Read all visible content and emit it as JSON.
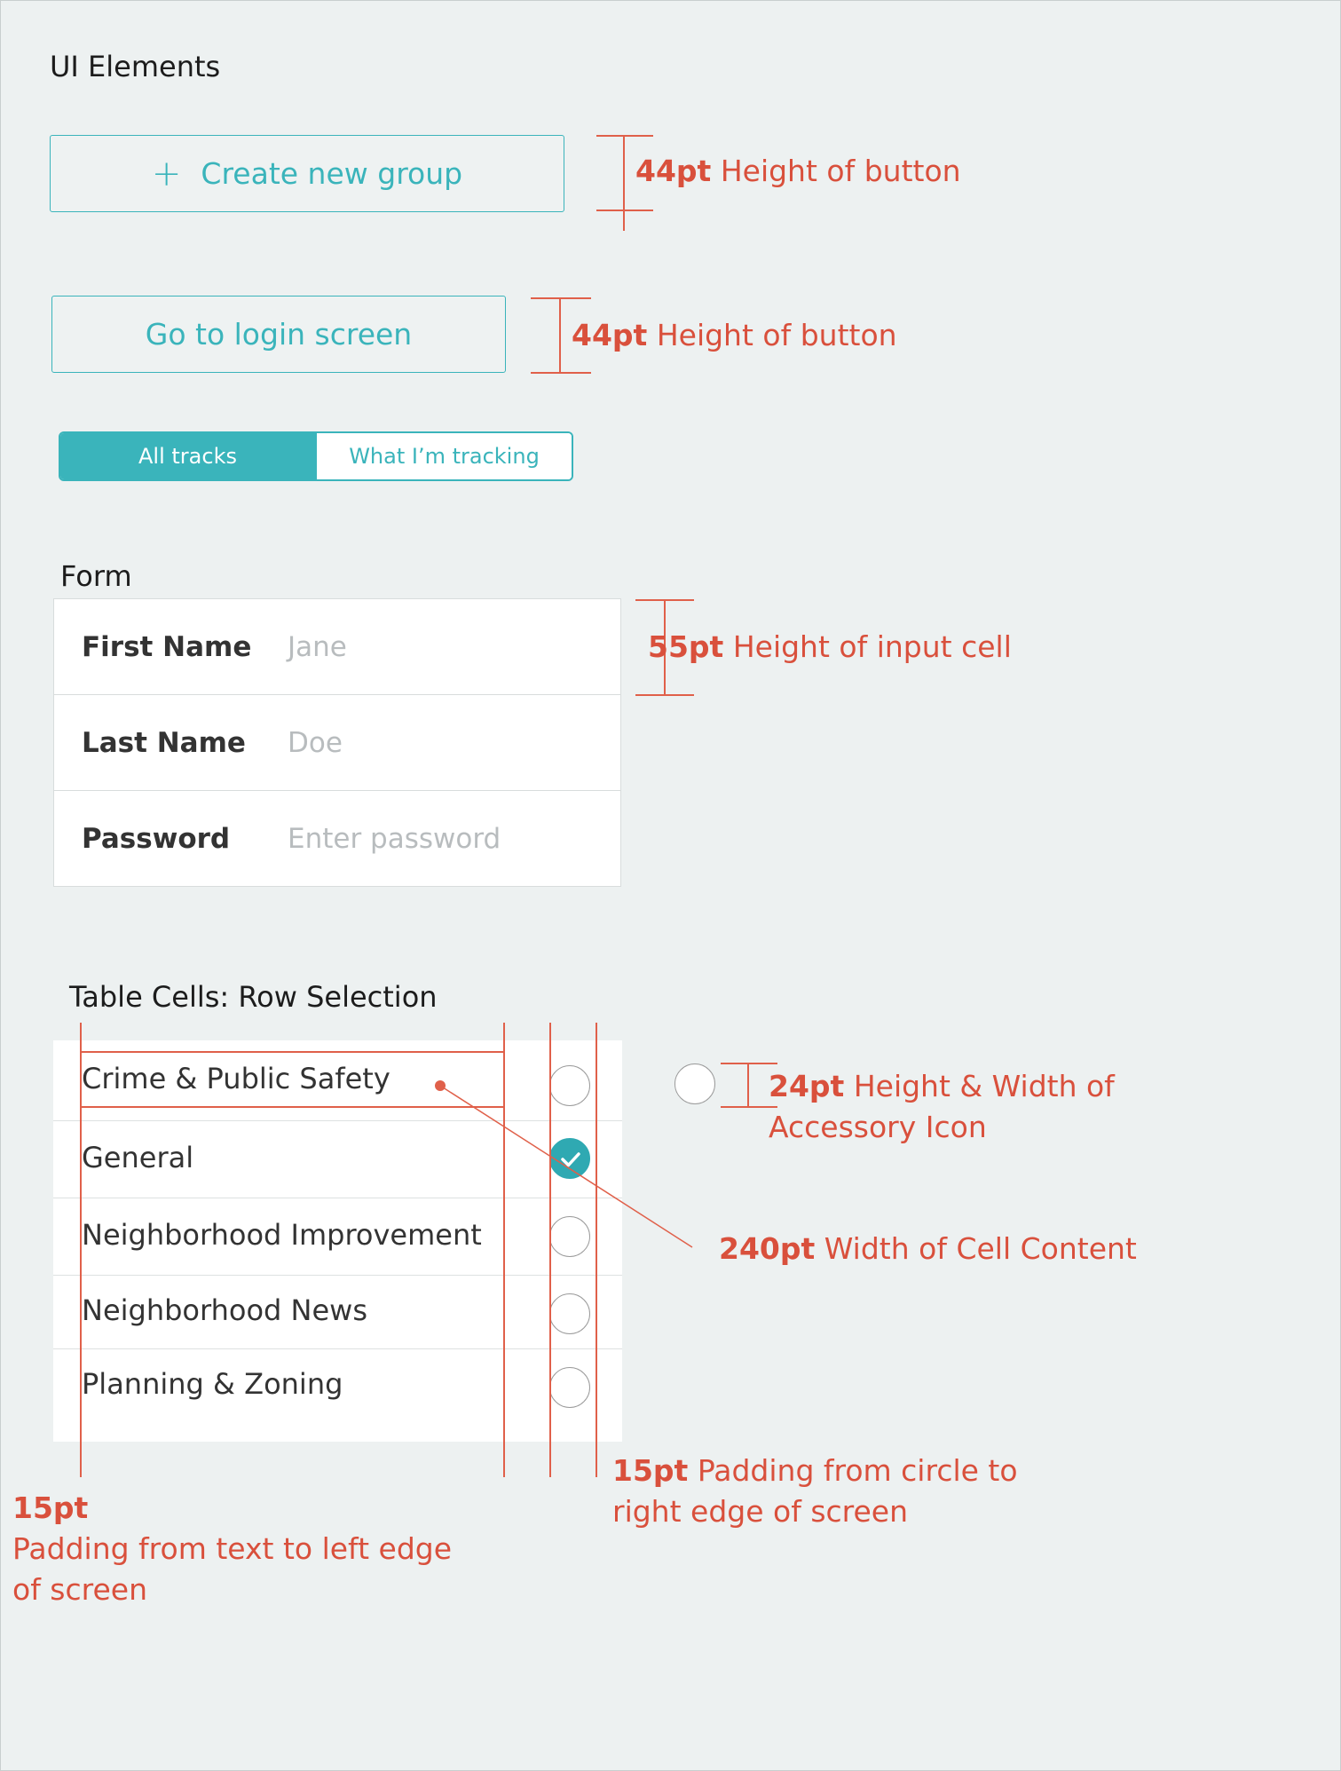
{
  "sections": {
    "ui_elements": "UI Elements",
    "form": "Form",
    "table": "Table Cells: Row Selection"
  },
  "buttons": {
    "create_group_label": "Create new group",
    "create_group_icon": "plus-icon",
    "login_label": "Go to login screen"
  },
  "segmented": {
    "active": "All tracks",
    "inactive": "What I’m tracking"
  },
  "form": {
    "rows": [
      {
        "label": "First Name",
        "placeholder": "Jane"
      },
      {
        "label": "Last Name",
        "placeholder": "Doe"
      },
      {
        "label": "Password",
        "placeholder": "Enter password"
      }
    ]
  },
  "table": {
    "rows": [
      {
        "label": "Crime & Public Safety",
        "checked": false
      },
      {
        "label": "General",
        "checked": true
      },
      {
        "label": "Neighborhood Improvement",
        "checked": false
      },
      {
        "label": "Neighborhood News",
        "checked": false
      },
      {
        "label": "Planning & Zoning",
        "checked": false
      }
    ]
  },
  "annotations": {
    "btn1": {
      "value": "44pt",
      "text": "Height of button"
    },
    "btn2": {
      "value": "44pt",
      "text": "Height of button"
    },
    "input": {
      "value": "55pt",
      "text": "Height of input cell"
    },
    "icon": {
      "value": "24pt",
      "text_line1": "Height & Width of",
      "text_line2": "Accessory Icon"
    },
    "cell_width": {
      "value": "240pt",
      "text": "Width of Cell Content"
    },
    "left_pad": {
      "value": "15pt",
      "text_line1": "Padding from text to left edge",
      "text_line2": "of screen"
    },
    "right_pad": {
      "value": "15pt",
      "text_line1": "Padding from circle to",
      "text_line2": "right edge of screen"
    }
  },
  "colors": {
    "accent": "#3ab4bb",
    "annotation": "#d9503c",
    "background": "#edf1f1"
  }
}
